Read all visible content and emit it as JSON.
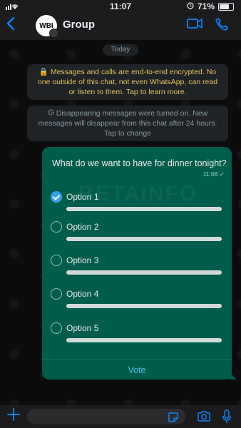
{
  "status_bar": {
    "time": "11:07",
    "battery": "71%"
  },
  "header": {
    "title": "Group",
    "avatar_text": "WBI"
  },
  "chat": {
    "date_chip": "Today",
    "encryption_notice": "Messages and calls are end-to-end encrypted. No one outside of this chat, not even WhatsApp, can read or listen to them. Tap to learn more.",
    "disappearing_notice": "Disappearing messages were turned on. New messages will disappear from this chat after 24 hours. Tap to change"
  },
  "poll": {
    "question": "What do we want to have for dinner tonight?",
    "time": "11:06",
    "options": [
      {
        "label": "Option 1",
        "checked": true
      },
      {
        "label": "Option 2",
        "checked": false
      },
      {
        "label": "Option 3",
        "checked": false
      },
      {
        "label": "Option 4",
        "checked": false
      },
      {
        "label": "Option 5",
        "checked": false
      }
    ],
    "vote_label": "Vote"
  },
  "watermark": "BETAINFO",
  "input_bar": {
    "message_value": ""
  },
  "colors": {
    "accent": "#0a84ff",
    "bubble": "#005c4b",
    "notice_yellow": "#e6c15a"
  }
}
